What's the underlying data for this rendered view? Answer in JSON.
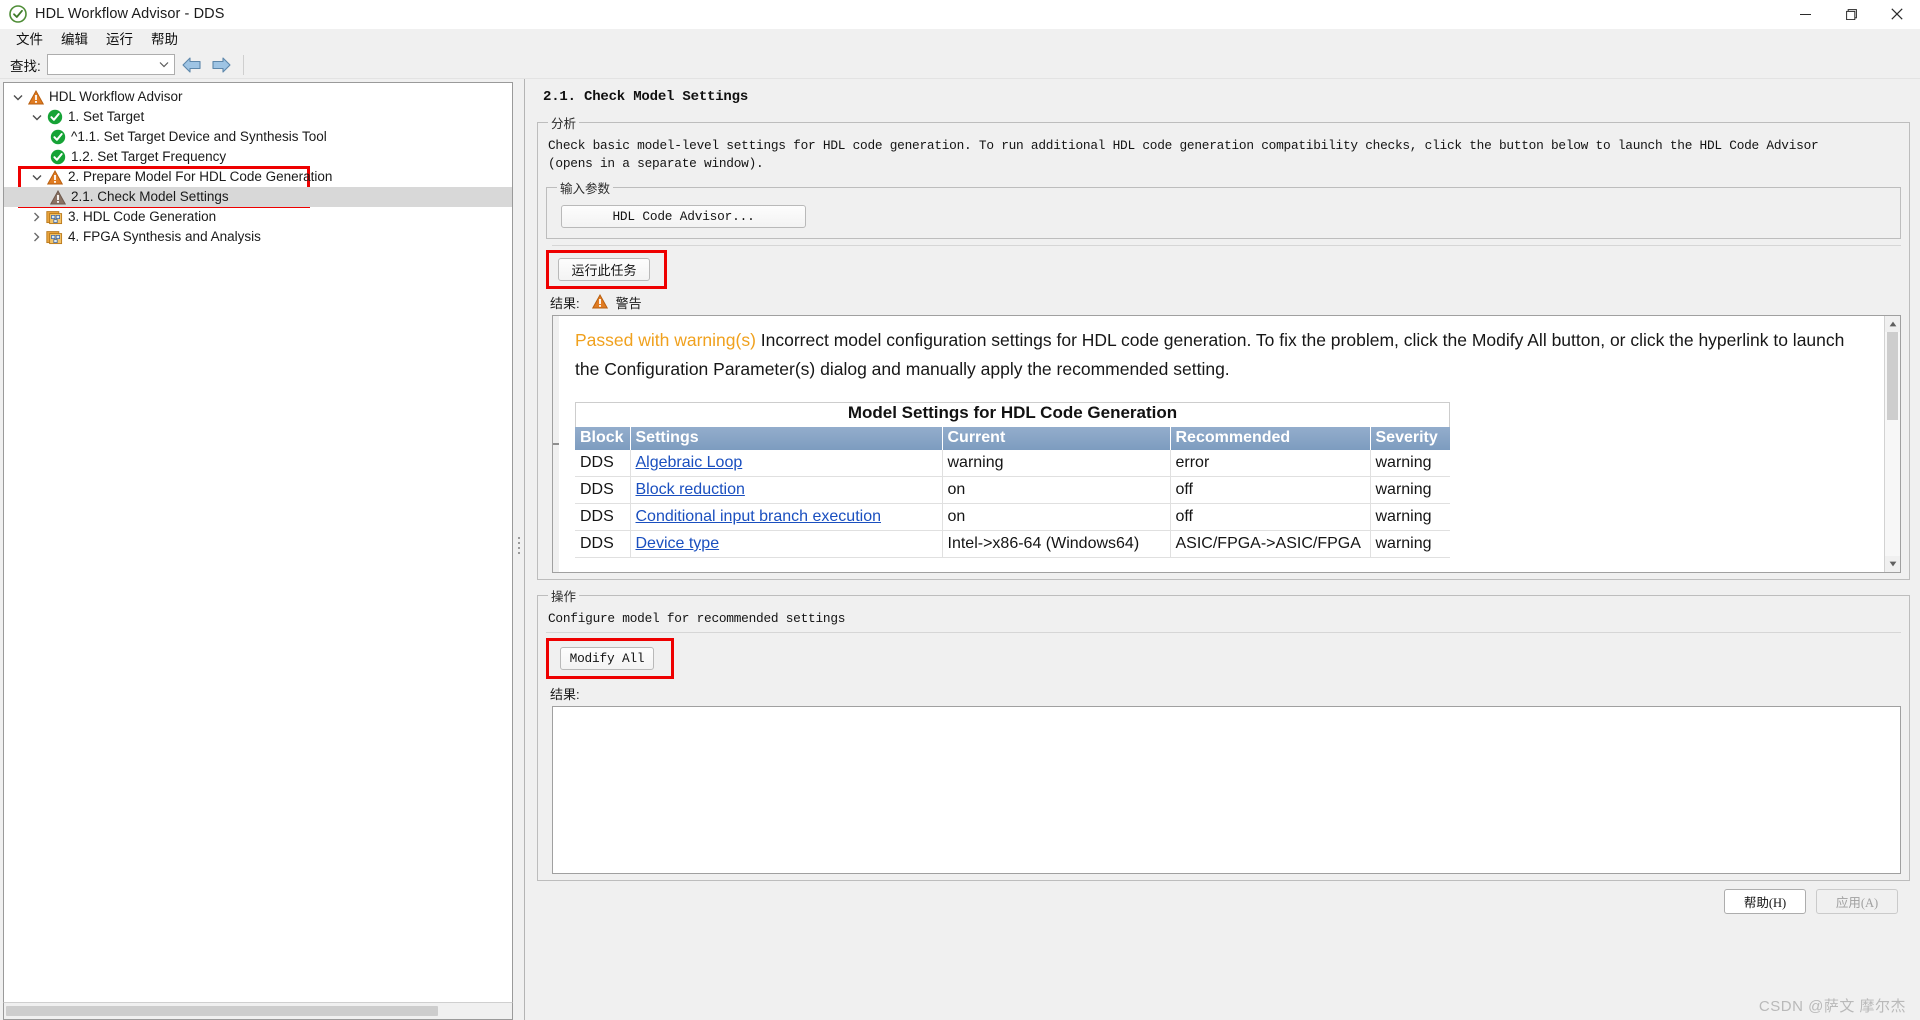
{
  "window": {
    "title": "HDL Workflow Advisor - DDS",
    "app_icon": "check-circle-icon",
    "minimize": "minimize-icon",
    "maximize": "maximize-icon",
    "close": "close-icon"
  },
  "menubar": {
    "items": [
      {
        "label": "文件"
      },
      {
        "label": "编辑"
      },
      {
        "label": "运行"
      },
      {
        "label": "帮助"
      }
    ]
  },
  "toolbar": {
    "find_label": "查找:",
    "find_value": "",
    "find_placeholder": "",
    "back_icon": "arrow-left-icon",
    "forward_icon": "arrow-right-icon"
  },
  "tree": {
    "items": [
      {
        "label": "HDL Workflow Advisor",
        "level": 0,
        "icon": "warning-triangle-icon",
        "twisty": "expanded",
        "selected": false,
        "highlighted": false
      },
      {
        "label": "1. Set Target",
        "level": 1,
        "icon": "check-circle-icon",
        "twisty": "expanded",
        "selected": false,
        "highlighted": false
      },
      {
        "label": "^1.1. Set Target Device and Synthesis Tool",
        "level": 2,
        "icon": "check-circle-icon",
        "twisty": "none",
        "selected": false,
        "highlighted": false
      },
      {
        "label": "1.2. Set Target Frequency",
        "level": 2,
        "icon": "check-circle-icon",
        "twisty": "none",
        "selected": false,
        "highlighted": false
      },
      {
        "label": "2. Prepare Model For HDL Code Generation",
        "level": 1,
        "icon": "warning-triangle-icon",
        "twisty": "expanded",
        "selected": false,
        "highlighted": true
      },
      {
        "label": "2.1. Check Model Settings",
        "level": 2,
        "icon": "warning-triangle-gray-icon",
        "twisty": "none",
        "selected": true,
        "highlighted": true
      },
      {
        "label": "3. HDL Code Generation",
        "level": 1,
        "icon": "folder-blocks-icon",
        "twisty": "collapsed",
        "selected": false,
        "highlighted": false
      },
      {
        "label": "4. FPGA Synthesis and Analysis",
        "level": 1,
        "icon": "folder-blocks-icon",
        "twisty": "collapsed",
        "selected": false,
        "highlighted": false
      }
    ]
  },
  "main": {
    "pane_title": "2.1. Check Model Settings",
    "analysis_group_label": "分析",
    "analysis_description": "Check basic model-level settings for HDL code generation. To run additional HDL code generation compatibility checks, click the button below to launch the HDL Code Advisor (opens in a separate window).",
    "analysis_description_line1": "Check basic model-level settings for HDL code generation. To run additional HDL code generation compatibility checks, click the button below to launch the HDL Code Advisor",
    "analysis_description_line2": "(opens in a separate window).",
    "input_params_group_label": "输入参数",
    "hdl_code_advisor_button": "HDL Code Advisor...",
    "run_task_button": "运行此任务",
    "result_label": "结果:",
    "result_status": "警告",
    "result_status_icon": "warning-triangle-icon",
    "warning_prefix": "Passed with warning(s)",
    "warning_body": " Incorrect model configuration settings for HDL code generation. To fix the problem, click the Modify All button, or click the hyperlink to launch the Configuration Parameter(s) dialog and manually apply the recommended setting.",
    "action_group_label": "操作",
    "action_description": "Configure model for recommended settings",
    "modify_all_button": "Modify All",
    "action_result_label": "结果:",
    "action_result_value": ""
  },
  "table": {
    "caption": "Model Settings for HDL Code Generation",
    "columns": [
      "Block",
      "Settings",
      "Current",
      "Recommended",
      "Severity"
    ],
    "rows": [
      {
        "block": "DDS",
        "settings": "Algebraic Loop",
        "current": "warning",
        "recommended": "error",
        "severity": "warning"
      },
      {
        "block": "DDS",
        "settings": "Block reduction",
        "current": "on",
        "recommended": "off",
        "severity": "warning"
      },
      {
        "block": "DDS",
        "settings": "Conditional input branch execution",
        "current": "on",
        "recommended": "off",
        "severity": "warning"
      },
      {
        "block": "DDS",
        "settings": "Device type",
        "current": "Intel->x86-64 (Windows64)",
        "recommended": "ASIC/FPGA->ASIC/FPGA",
        "severity": "warning"
      }
    ]
  },
  "footer": {
    "help_button": "帮助(H)",
    "apply_button": "应用(A)",
    "watermark": "CSDN @萨文 摩尔杰"
  },
  "colors": {
    "accent_warning": "#f0a11e",
    "table_header": "#7d9cbf",
    "link": "#1a4fbf",
    "highlight_box": "#ee0000",
    "selection": "#d8d8d8"
  }
}
